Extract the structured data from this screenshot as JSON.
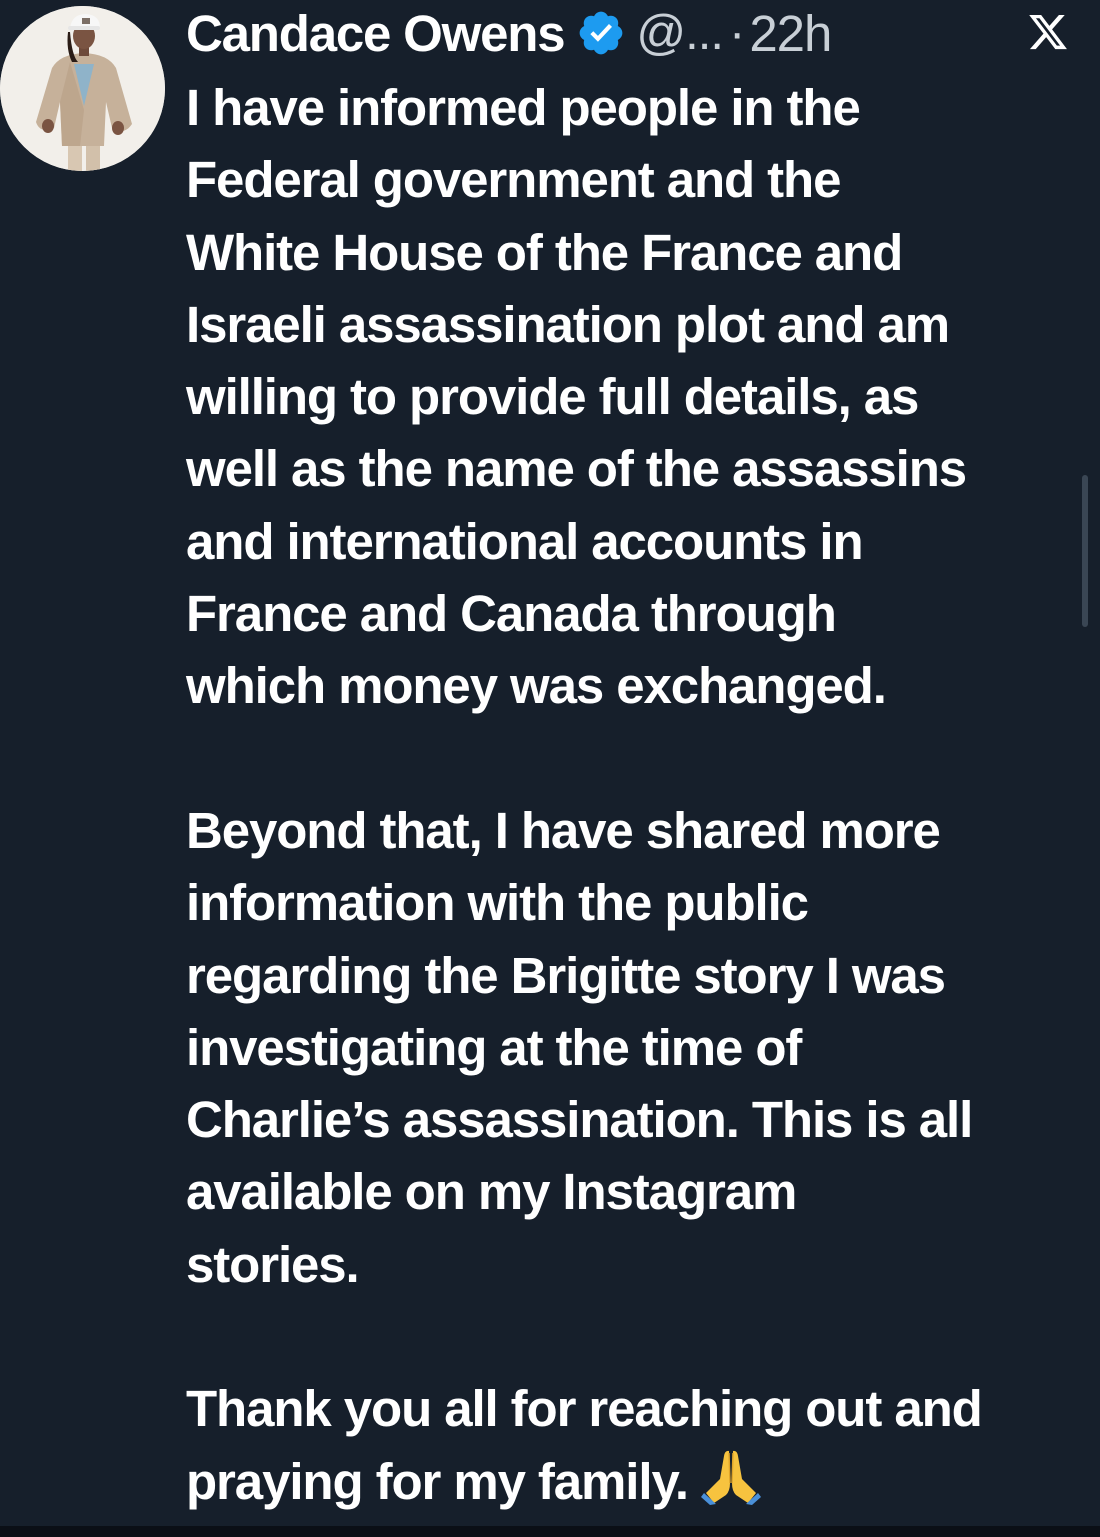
{
  "tweet": {
    "author": {
      "display_name": "Candace Owens",
      "verified": true,
      "handle": "@...",
      "avatar_icon": "profile-photo"
    },
    "separator": "·",
    "timestamp": "22h",
    "platform_icon": "x-logo-icon",
    "paragraphs": [
      {
        "lines": [
          "I have informed people in the",
          "Federal government and the",
          "White House of the France and",
          "Israeli assassination plot and am",
          "willing to provide full details, as",
          "well as the name of the assassins",
          "and international accounts in",
          "France and Canada through",
          "which money was exchanged."
        ]
      },
      {
        "lines": [
          "Beyond that, I have shared more",
          "information with the public",
          "regarding the Brigitte story I was",
          "investigating at the time of",
          "Charlie’s assassination. This is all",
          "available on my Instagram",
          "stories."
        ]
      },
      {
        "lines": [
          "Thank you all for reaching out and",
          "praying for my family."
        ],
        "trailing_emoji": "folded-hands-emoji"
      }
    ]
  },
  "colors": {
    "background": "#161f2b",
    "text_primary": "#ffffff",
    "text_secondary": "#c8cfd6",
    "verified_badge": "#1d9bf0"
  }
}
